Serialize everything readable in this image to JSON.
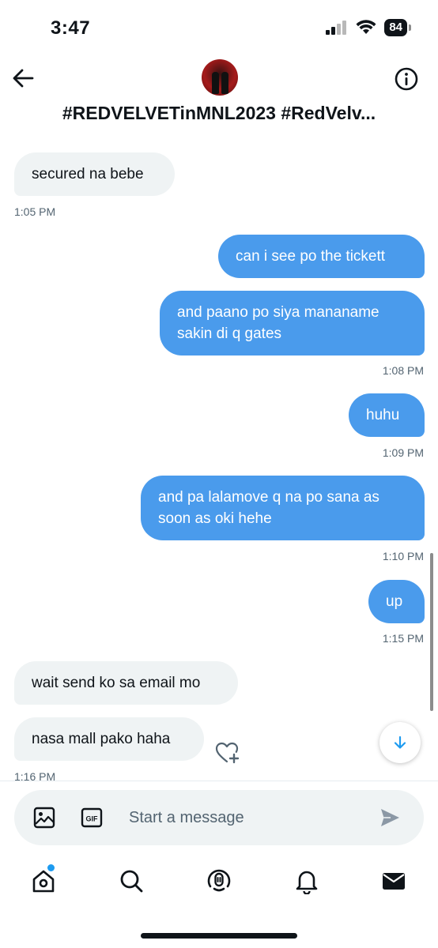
{
  "status_bar": {
    "time": "3:47",
    "battery": "84"
  },
  "header": {
    "title": "#REDVELVETinMNL2023 #RedVelv..."
  },
  "messages": [
    {
      "dir": "in",
      "text": "secured na bebe"
    },
    {
      "time": "1:05 PM"
    },
    {
      "dir": "out",
      "text": "can i see po the tickett"
    },
    {
      "dir": "out",
      "text": "and paano po siya mananame sakin di q gates"
    },
    {
      "time": "1:08 PM"
    },
    {
      "dir": "out",
      "text": "huhu"
    },
    {
      "time": "1:09 PM"
    },
    {
      "dir": "out",
      "text": "and pa lalamove q na po sana as soon as oki hehe"
    },
    {
      "time": "1:10 PM"
    },
    {
      "dir": "out",
      "text": "up"
    },
    {
      "time": "1:15 PM"
    },
    {
      "dir": "in",
      "text": "wait send ko sa email mo"
    },
    {
      "dir": "in",
      "text": "nasa mall pako haha"
    },
    {
      "time": "1:16 PM"
    }
  ],
  "composer": {
    "placeholder": "Start a message",
    "gif_label": "GIF"
  },
  "tabs": [
    "home-icon",
    "search-icon",
    "spaces-icon",
    "notifications-icon",
    "messages-icon"
  ],
  "colors": {
    "outgoing": "#4a9bec",
    "incoming": "#eff3f4",
    "accent": "#1d9bf0"
  }
}
